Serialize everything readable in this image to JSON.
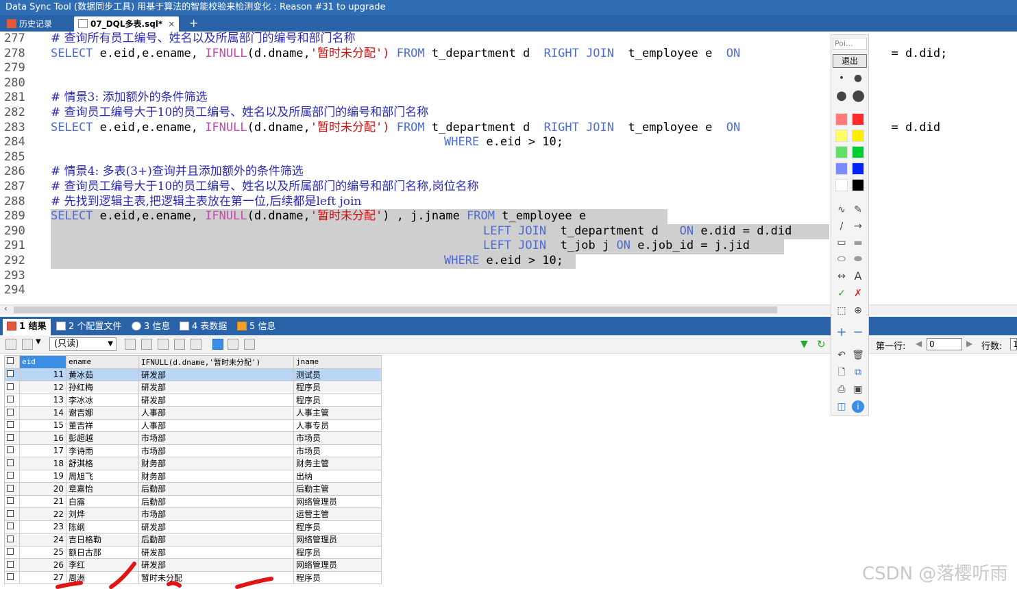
{
  "window": {
    "title": "Data Sync Tool (数据同步工具) 用基于算法的智能校验来检测变化 : Reason #31 to upgrade"
  },
  "tabs": [
    {
      "label": "历史记录",
      "active": false
    },
    {
      "label": "07_DQL多表.sql*",
      "active": true,
      "close": "×"
    }
  ],
  "add_tab": "+",
  "editor": {
    "lines": [
      {
        "n": "277"
      },
      {
        "n": "278"
      },
      {
        "n": "279"
      },
      {
        "n": "280"
      },
      {
        "n": "281"
      },
      {
        "n": "282"
      },
      {
        "n": "283"
      },
      {
        "n": "284"
      },
      {
        "n": "285"
      },
      {
        "n": "286"
      },
      {
        "n": "287"
      },
      {
        "n": "288"
      },
      {
        "n": "289"
      },
      {
        "n": "290"
      },
      {
        "n": "291"
      },
      {
        "n": "292"
      },
      {
        "n": "293"
      },
      {
        "n": "294"
      }
    ],
    "code": {
      "l277": "# 查询所有员工编号、姓名以及所属部门的编号和部门名称",
      "l278_a": "SELECT",
      "l278_b": " e.eid,e.ename, ",
      "l278_c": "IFNULL",
      "l278_d": "(d.dname,",
      "l278_e": "'暂时未分配'",
      "l278_f": ") ",
      "l278_g": "FROM",
      "l278_h": " t_department d  ",
      "l278_i": "RIGHT JOIN",
      "l278_j": "  t_employee e  ",
      "l278_k": "ON",
      "l278_l": "  = d.did;",
      "l281": "# 情景3: 添加额外的条件筛选",
      "l282": "# 查询员工编号大于10的员工编号、姓名以及所属部门的编号和部门名称",
      "l283_a": "SELECT",
      "l283_b": " e.eid,e.ename, ",
      "l283_c": "IFNULL",
      "l283_d": "(d.dname,",
      "l283_e": "'暂时未分配'",
      "l283_f": ") ",
      "l283_g": "FROM",
      "l283_h": " t_department d  ",
      "l283_i": "RIGHT JOIN",
      "l283_j": "  t_employee e  ",
      "l283_k": "ON",
      "l283_l": "  = d.did",
      "l284_a": "WHERE",
      "l284_b": " e.eid > 10;",
      "l286": "# 情景4: 多表(3+)查询并且添加额外的条件筛选",
      "l287": "# 查询员工编号大于10的员工编号、姓名以及所属部门的编号和部门名称,岗位名称",
      "l288": "# 先找到逻辑主表,把逻辑主表放在第一位,后续都是left join",
      "l289_a": "SELECT",
      "l289_b": " e.eid,e.ename, ",
      "l289_c": "IFNULL",
      "l289_d": "(d.dname,",
      "l289_e": "'暂时未分配'",
      "l289_f": ") , j.jname ",
      "l289_g": "FROM",
      "l289_h": " t_employee e",
      "l290_a": "LEFT JOIN",
      "l290_b": "  t_department d   ",
      "l290_c": "ON",
      "l290_d": " e.did = d.did",
      "l291_a": "LEFT JOIN",
      "l291_b": "  t_job j ",
      "l291_c": "ON",
      "l291_d": " e.job_id = j.jid",
      "l292_a": "WHERE",
      "l292_b": " e.eid > 10;"
    }
  },
  "bottom_tabs": [
    {
      "label": "1 结果",
      "active": true
    },
    {
      "label": "2 个配置文件",
      "active": false
    },
    {
      "label": "3 信息",
      "active": false
    },
    {
      "label": "4 表数据",
      "active": false
    },
    {
      "label": "5 信息",
      "active": false
    }
  ],
  "result_toolbar": {
    "mode_select": "(只读)",
    "first_row_label": "第一行:",
    "first_row_value": "0",
    "row_count_label": "行数:",
    "row_count_value": "1"
  },
  "grid": {
    "columns": [
      "eid",
      "ename",
      "IFNULL(d.dname,'暂时未分配')",
      "jname"
    ],
    "rows": [
      [
        "11",
        "黄冰茹",
        "研发部",
        "测试员"
      ],
      [
        "12",
        "孙红梅",
        "研发部",
        "程序员"
      ],
      [
        "13",
        "李冰冰",
        "研发部",
        "程序员"
      ],
      [
        "14",
        "谢吉娜",
        "人事部",
        "人事主管"
      ],
      [
        "15",
        "董吉祥",
        "人事部",
        "人事专员"
      ],
      [
        "16",
        "彭超越",
        "市场部",
        "市场员"
      ],
      [
        "17",
        "李诗雨",
        "市场部",
        "市场员"
      ],
      [
        "18",
        "舒淇格",
        "财务部",
        "财务主管"
      ],
      [
        "19",
        "周旭飞",
        "财务部",
        "出纳"
      ],
      [
        "20",
        "章嘉怡",
        "后勤部",
        "后勤主管"
      ],
      [
        "21",
        "白露",
        "后勤部",
        "网络管理员"
      ],
      [
        "22",
        "刘烨",
        "市场部",
        "运营主管"
      ],
      [
        "23",
        "陈纲",
        "研发部",
        "程序员"
      ],
      [
        "24",
        "吉日格勒",
        "后勤部",
        "网络管理员"
      ],
      [
        "25",
        "额日古那",
        "研发部",
        "程序员"
      ],
      [
        "26",
        "李红",
        "研发部",
        "网络管理员"
      ],
      [
        "27",
        "周洲",
        "暂时未分配",
        "程序员"
      ]
    ]
  },
  "palette": {
    "poi": "Poi...",
    "exit": "退出",
    "colors": [
      "#ff7b7b",
      "#ff2a2a",
      "#ffff66",
      "#ffee00",
      "#66dd66",
      "#00cc33",
      "#7b8bff",
      "#0022ff",
      "#ffffff",
      "#000000"
    ]
  },
  "watermark": "CSDN @落樱听雨"
}
